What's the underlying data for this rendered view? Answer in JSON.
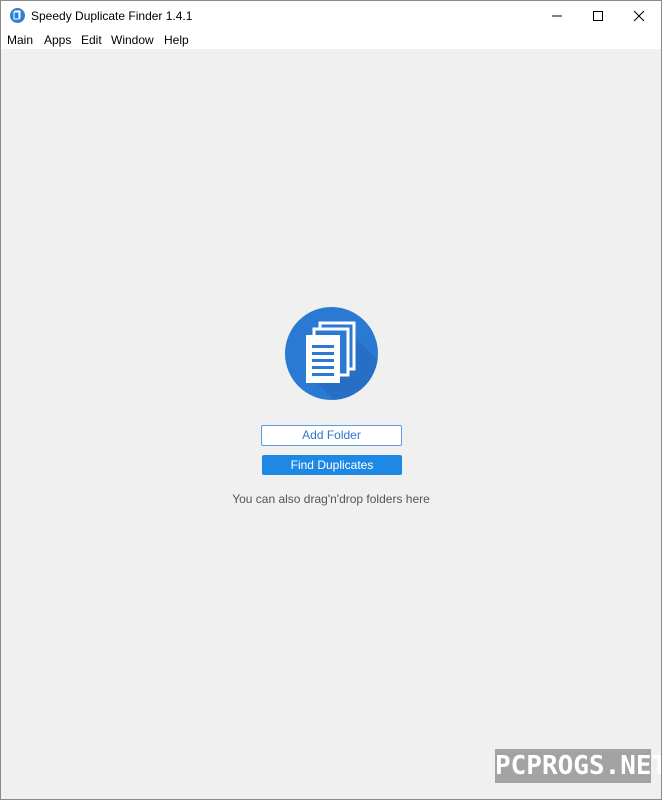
{
  "window": {
    "title": "Speedy Duplicate Finder 1.4.1",
    "app_icon": "app-logo-icon",
    "controls": [
      "minimize-icon",
      "maximize-icon",
      "close-icon"
    ]
  },
  "menu": {
    "items": [
      "Main",
      "Apps",
      "Edit",
      "Window",
      "Help"
    ]
  },
  "main": {
    "logo_icon": "duplicate-documents-icon",
    "add_folder_label": "Add Folder",
    "find_duplicates_label": "Find Duplicates",
    "hint": "You can also drag'n'drop folders here"
  },
  "watermark": {
    "text": "PCPROGS.NET"
  },
  "colors": {
    "accent": "#1e88e5",
    "logo_blue": "#2a79d3",
    "background": "#f0f0f0"
  }
}
